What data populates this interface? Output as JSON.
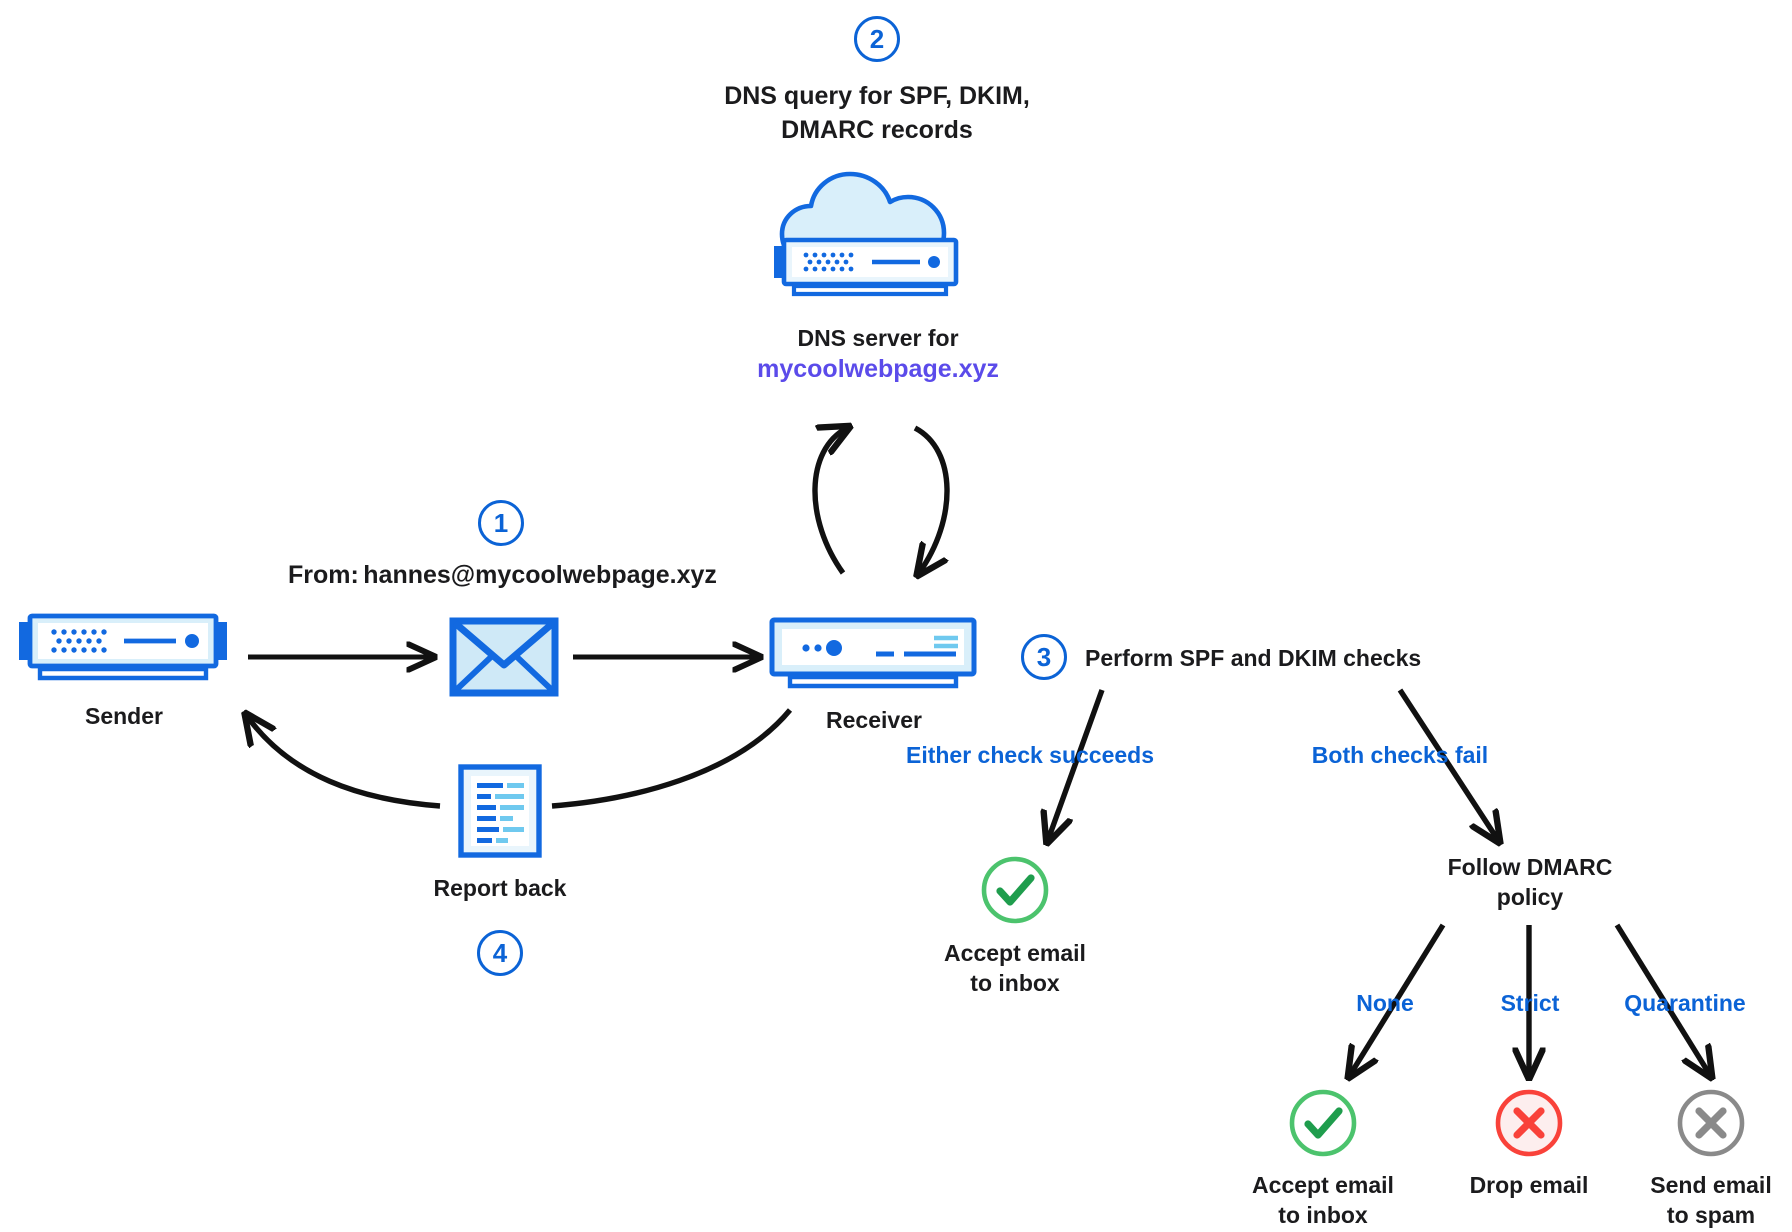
{
  "diagram": {
    "title": "Email authentication flow (SPF, DKIM, DMARC)",
    "colors": {
      "blue": "#0b63d6",
      "blue_dark": "#1269e0",
      "blue_fill": "#cfe9f7",
      "blue_fill_light": "#e9f5fc",
      "purple": "#5b4bea",
      "green": "#4cc36d",
      "green_dark": "#1f9d4d",
      "red": "#f9423a",
      "red_fill": "#fdeeee",
      "gray": "#8a8a8a",
      "black": "#1b1b1d",
      "arrow": "#111111"
    }
  },
  "steps": {
    "one": "1",
    "two": "2",
    "three": "3",
    "four": "4"
  },
  "nodes": {
    "dns_query_caption": "DNS query for SPF, DKIM,\nDMARC records",
    "dns_server_label": "DNS server for",
    "dns_server_domain": "mycoolwebpage.xyz",
    "from_prefix": "From:",
    "from_address": "hannes@mycoolwebpage.xyz",
    "sender_label": "Sender",
    "receiver_label": "Receiver",
    "report_back_label": "Report back",
    "perform_checks_label": "Perform SPF and DKIM checks",
    "either_check_succeeds": "Either check succeeds",
    "both_checks_fail": "Both checks fail",
    "accept_email_inbox_1": "Accept email\nto inbox",
    "follow_dmarc_policy": "Follow DMARC\npolicy",
    "policy_none": "None",
    "policy_strict": "Strict",
    "policy_quarantine": "Quarantine",
    "accept_email_inbox_2": "Accept email\nto inbox",
    "drop_email": "Drop email",
    "send_email_spam": "Send email\nto spam"
  },
  "icons": {
    "dns_cloud_server": "cloud-server-icon",
    "sender_server": "server-icon",
    "receiver_server": "server-icon",
    "envelope": "envelope-icon",
    "report": "document-report-icon",
    "check_1": "check-circle-icon",
    "check_2": "check-circle-icon",
    "cross_red": "x-circle-icon",
    "cross_gray": "x-circle-icon"
  }
}
